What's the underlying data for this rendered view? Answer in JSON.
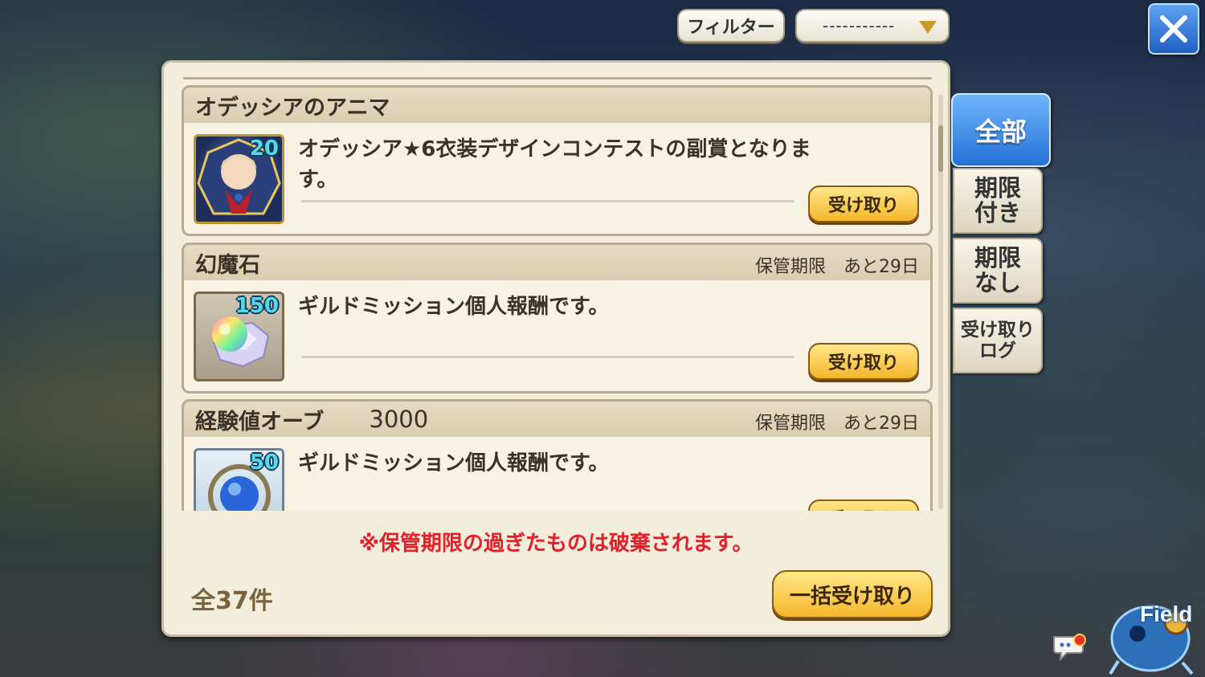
{
  "top": {
    "filter_label": "フィルター",
    "filter_value": "-----------"
  },
  "rewards": [
    {
      "title": "オデッシアのアニマ",
      "amount": "",
      "expiry_label": "",
      "expiry_value": "",
      "count": "20",
      "description": "オデッシア★6衣装デザインコンテストの副賞となります。",
      "claim_label": "受け取り",
      "icon": "character-portrait-icon"
    },
    {
      "title": "幻魔石",
      "amount": "",
      "expiry_label": "保管期限",
      "expiry_value": "あと29日",
      "count": "150",
      "description": "ギルドミッション個人報酬です。",
      "claim_label": "受け取り",
      "icon": "magicite-crystal-icon"
    },
    {
      "title": "経験値オーブ",
      "amount": "3000",
      "expiry_label": "保管期限",
      "expiry_value": "あと29日",
      "count": "50",
      "description": "ギルドミッション個人報酬です。",
      "claim_label": "受け取り",
      "icon": "experience-orb-icon"
    }
  ],
  "notice": "※保管期限の過ぎたものは破棄されます。",
  "total": "全37件",
  "bulk_claim_label": "一括受け取り",
  "tabs": [
    {
      "label": "全部",
      "active": true
    },
    {
      "label": "期限\n付き",
      "active": false
    },
    {
      "label": "期限\nなし",
      "active": false
    },
    {
      "label": "受け取り\nログ",
      "active": false
    }
  ],
  "field_label": "Field",
  "colors": {
    "notice": "#e0212a",
    "active_tab": "#2470d6",
    "claim_button": "#f5b62a"
  }
}
